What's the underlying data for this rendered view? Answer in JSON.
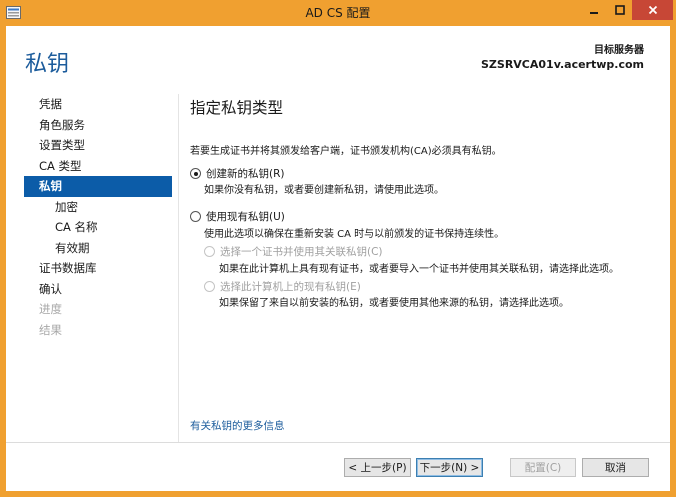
{
  "window": {
    "title": "AD CS 配置"
  },
  "header": {
    "page_title": "私钥",
    "target_label": "目标服务器",
    "target_server": "SZSRVCA01v.acertwp.com"
  },
  "nav": {
    "items": [
      {
        "label": "凭据"
      },
      {
        "label": "角色服务"
      },
      {
        "label": "设置类型"
      },
      {
        "label": "CA 类型"
      },
      {
        "label": "私钥"
      },
      {
        "label": "加密"
      },
      {
        "label": "CA 名称"
      },
      {
        "label": "有效期"
      },
      {
        "label": "证书数据库"
      },
      {
        "label": "确认"
      },
      {
        "label": "进度"
      },
      {
        "label": "结果"
      }
    ]
  },
  "content": {
    "section_title": "指定私钥类型",
    "description": "若要生成证书并将其颁发给客户端，证书颁发机构(CA)必须具有私钥。",
    "option_new": {
      "label": "创建新的私钥(R)",
      "hint": "如果你没有私钥，或者要创建新私钥，请使用此选项。"
    },
    "option_existing": {
      "label": "使用现有私钥(U)",
      "hint": "使用此选项以确保在重新安装 CA 时与以前颁发的证书保持连续性。"
    },
    "sub_option_cert": {
      "label": "选择一个证书并使用其关联私钥(C)",
      "hint": "如果在此计算机上具有现有证书，或者要导入一个证书并使用其关联私钥，请选择此选项。"
    },
    "sub_option_key": {
      "label": "选择此计算机上的现有私钥(E)",
      "hint": "如果保留了来自以前安装的私钥，或者要使用其他来源的私钥，请选择此选项。"
    },
    "more_info_link": "有关私钥的更多信息"
  },
  "footer": {
    "prev": "< 上一步(P)",
    "next": "下一步(N) >",
    "configure": "配置(C)",
    "cancel": "取消"
  },
  "colors": {
    "title_bar": "#f0a030",
    "accent": "#0c5ca8",
    "page_title": "#1c5c9c",
    "close_button": "#c74736"
  },
  "icons": {
    "app": "server-manager-icon",
    "minimize": "minimize-icon",
    "maximize": "maximize-icon",
    "close": "close-icon"
  }
}
